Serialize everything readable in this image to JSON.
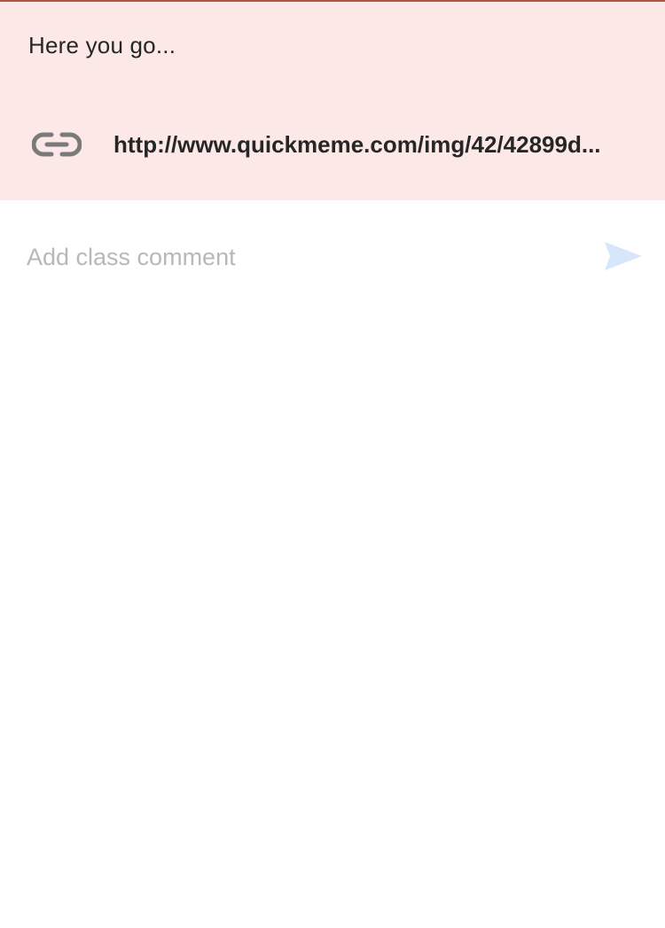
{
  "post": {
    "text": "Here you go...",
    "link": {
      "icon": "link-icon",
      "url": "http://www.quickmeme.com/img/42/42899d..."
    }
  },
  "comment": {
    "placeholder": "Add class comment",
    "value": "",
    "send_icon": "send-icon"
  },
  "colors": {
    "card_background": "#fbe8e7",
    "card_border": "#b5523f",
    "text": "#262626",
    "placeholder": "#b8b8b8",
    "send_icon": "#d7e6fb",
    "link_icon": "#7a7a7a"
  }
}
